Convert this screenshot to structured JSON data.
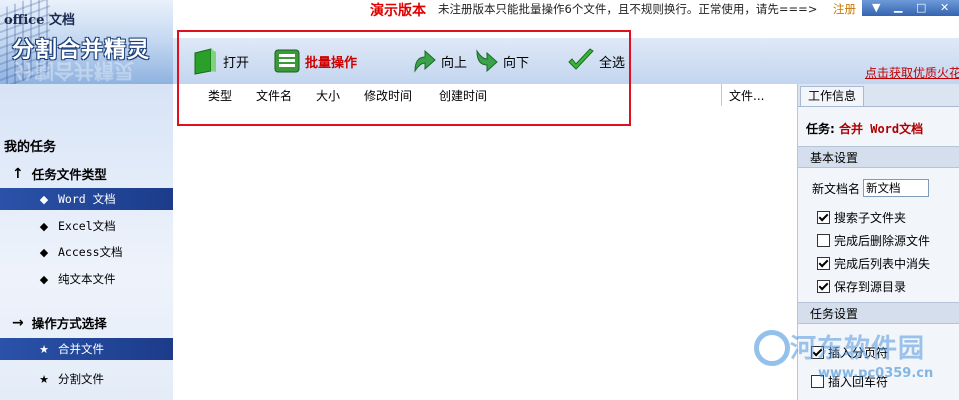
{
  "app": {
    "logo_small": "office 文档",
    "logo_big": "分割合并精灵"
  },
  "banner": {
    "demo_label": "演示版本",
    "notice": "未注册版本只能批量操作6个文件，且不规则换行。正常使用，请先===>",
    "register_link": "注册"
  },
  "toolbar": {
    "open": "打开",
    "batch": "批量操作",
    "up": "向上",
    "down": "向下",
    "select_all": "全选",
    "promo": "点击获取优质火花"
  },
  "sidebar": {
    "title": "我的任务",
    "group1": "任务文件类型",
    "types": [
      {
        "label": "Word 文档",
        "selected": true
      },
      {
        "label": "Excel文档",
        "selected": false
      },
      {
        "label": "Access文档",
        "selected": false
      },
      {
        "label": "纯文本文件",
        "selected": false
      }
    ],
    "group2": "操作方式选择",
    "modes": [
      {
        "label": "合并文件",
        "selected": true
      },
      {
        "label": "分割文件",
        "selected": false
      }
    ]
  },
  "filelist": {
    "columns": [
      "类型",
      "文件名",
      "大小",
      "修改时间",
      "创建时间"
    ],
    "last_column": "文件..."
  },
  "rpanel": {
    "tab": "工作信息",
    "task_label": "任务:",
    "task_value": "合并 Word文档",
    "basic_section": "基本设置",
    "new_doc_label": "新文档名",
    "new_doc_value": "新文档",
    "options": [
      {
        "label": "搜索子文件夹",
        "checked": true
      },
      {
        "label": "完成后删除源文件",
        "checked": false
      },
      {
        "label": "完成后列表中消失",
        "checked": true
      },
      {
        "label": "保存到源目录",
        "checked": true
      }
    ],
    "task_section": "任务设置",
    "task_options": [
      {
        "label": "插入分页符",
        "checked": true
      },
      {
        "label": "插入回车符",
        "checked": false
      }
    ]
  },
  "watermark": {
    "text": "河东软件园",
    "url": "www.pc0359.cn"
  },
  "colors": {
    "accent": "#1c3c8a",
    "demo_red": "#e00000",
    "highlight_box": "#e01020"
  }
}
